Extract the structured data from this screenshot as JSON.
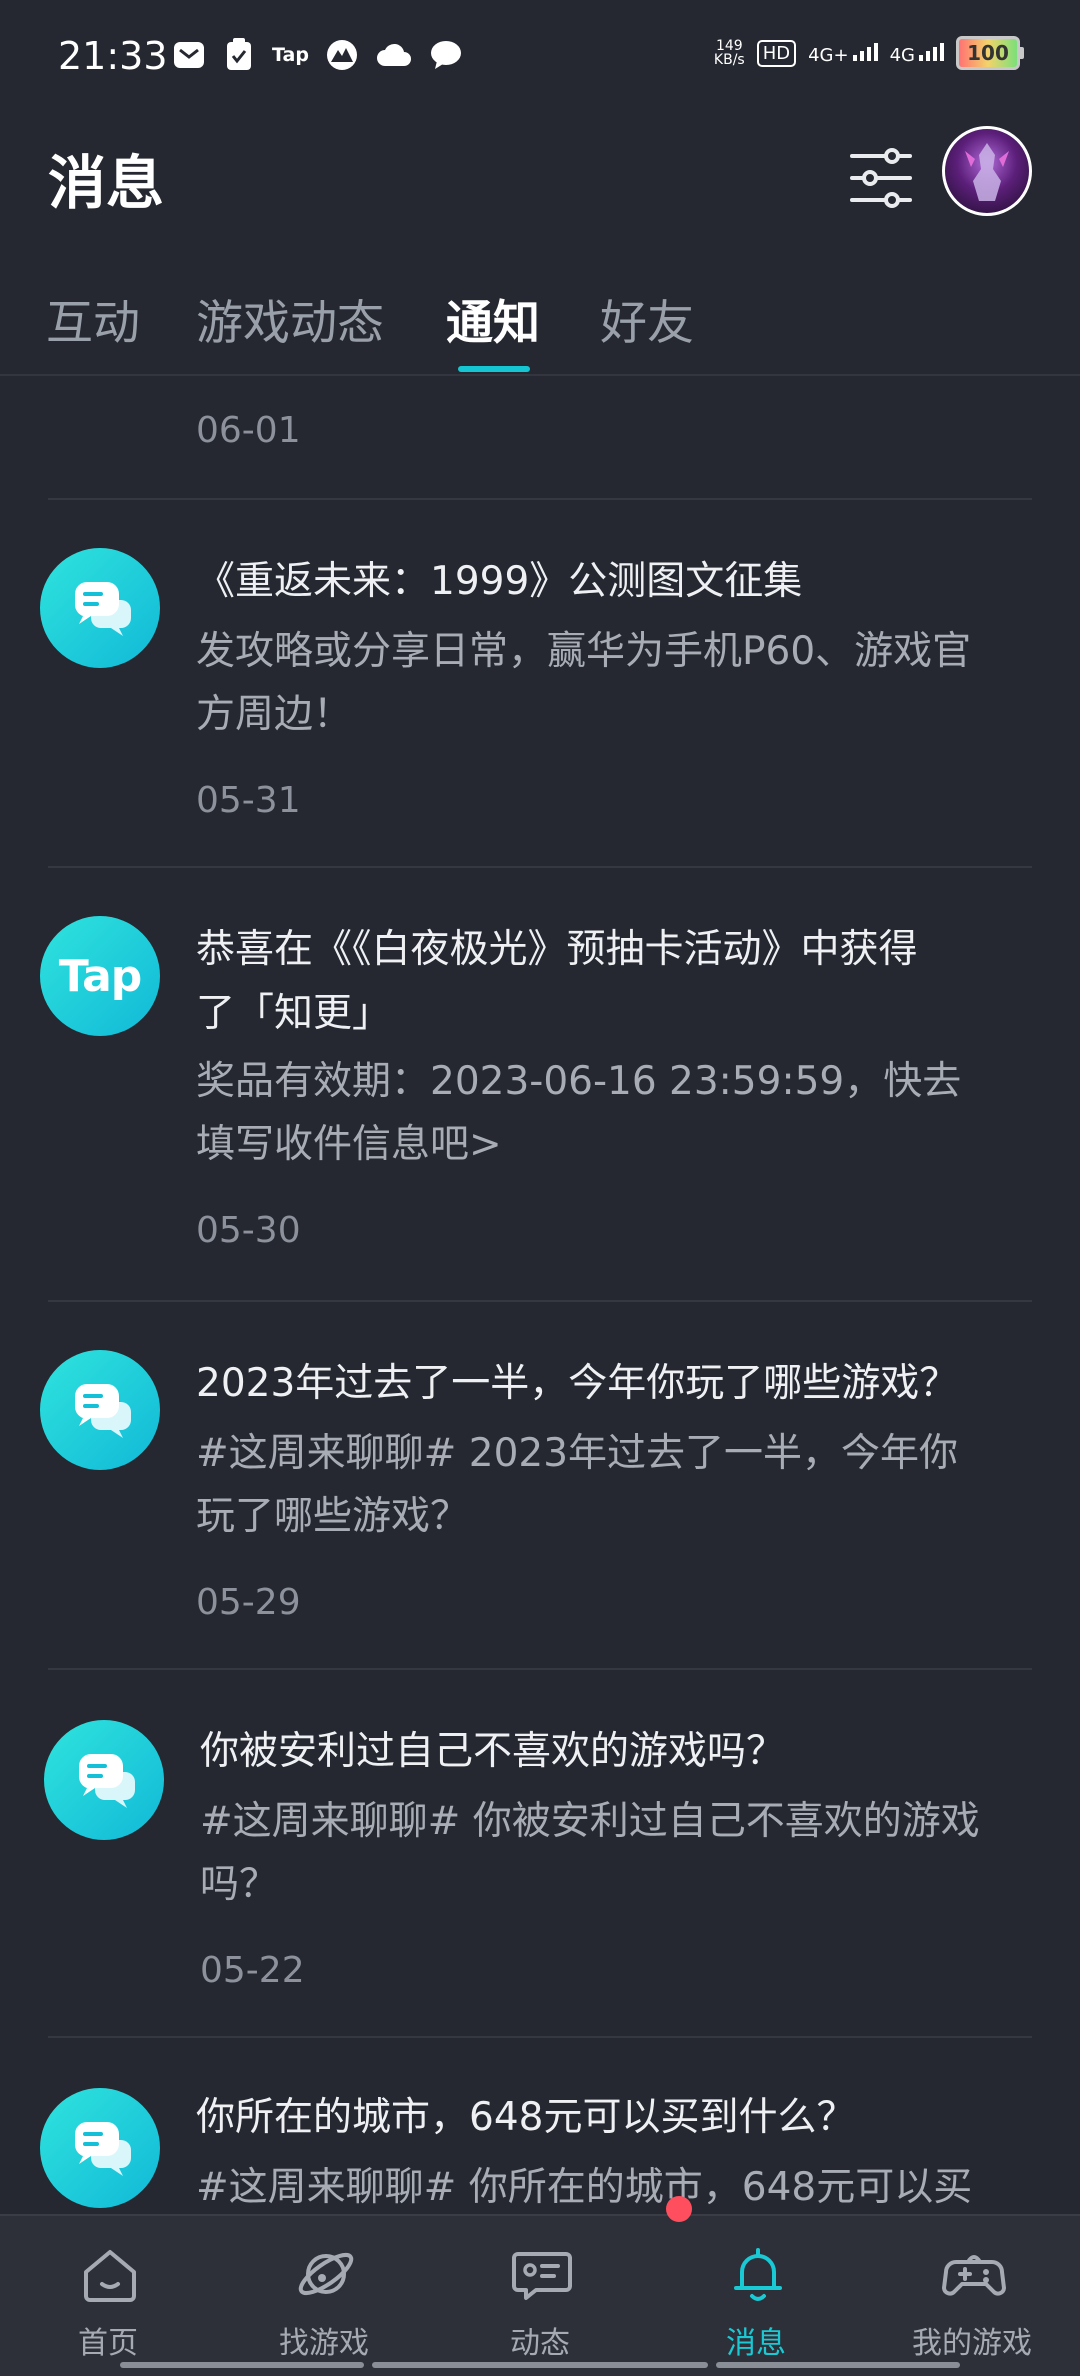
{
  "status_bar": {
    "time": "21:33",
    "net_speed_value": "149",
    "net_speed_unit": "KB/s",
    "hd_label": "HD",
    "signal1": "4G+",
    "signal2": "4G",
    "battery": "100",
    "tap_label": "Tap"
  },
  "header": {
    "title": "消息"
  },
  "tabs": [
    {
      "label": "互动",
      "active": false
    },
    {
      "label": "游戏动态",
      "active": false
    },
    {
      "label": "通知",
      "active": true
    },
    {
      "label": "好友",
      "active": false
    }
  ],
  "feed": {
    "top_date": "06-01",
    "items": [
      {
        "icon": "chat-bubble-icon",
        "title": "《重返未来：1999》公测图文征集",
        "desc_line1": "发攻略或分享日常，赢华为手机P60、游戏官",
        "desc_line2": "方周边！",
        "date": "05-31"
      },
      {
        "icon": "tap-logo",
        "logo_text": "Tap",
        "title_line1": "恭喜在《《白夜极光》预抽卡活动》中获得",
        "title_line2": "了「知更」",
        "desc_line1": "奖品有效期：2023-06-16 23:59:59，快去",
        "desc_line2": "填写收件信息吧>",
        "date": "05-30"
      },
      {
        "icon": "chat-bubble-icon",
        "title": "2023年过去了一半，今年你玩了哪些游戏？",
        "desc_line1": "#这周来聊聊# 2023年过去了一半，今年你",
        "desc_line2": "玩了哪些游戏？",
        "date": "05-29"
      },
      {
        "icon": "chat-bubble-icon",
        "title": "你被安利过自己不喜欢的游戏吗？",
        "desc_line1": "#这周来聊聊# 你被安利过自己不喜欢的游戏",
        "desc_line2": "吗？",
        "date": "05-22"
      },
      {
        "icon": "chat-bubble-icon",
        "title": "你所在的城市，648元可以买到什么？",
        "desc_line1": "#这周来聊聊# 你所在的城市，648元可以买"
      }
    ]
  },
  "bottom_nav": [
    {
      "label": "首页",
      "icon": "home-icon",
      "active": false
    },
    {
      "label": "找游戏",
      "icon": "planet-icon",
      "active": false
    },
    {
      "label": "动态",
      "icon": "feed-icon",
      "active": false
    },
    {
      "label": "消息",
      "icon": "bell-icon",
      "active": true
    },
    {
      "label": "我的游戏",
      "icon": "gamepad-icon",
      "active": false
    }
  ],
  "colors": {
    "background": "#252830",
    "accent": "#15c6d2",
    "badge": "#ff4f5e"
  }
}
